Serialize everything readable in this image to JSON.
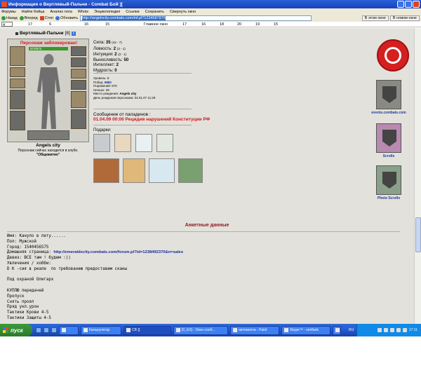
{
  "window": {
    "title": "Информация о Вертлявый-Пальчи - Combat Бой ][",
    "menu": [
      "Форумы",
      "Найти бойца",
      "Анализ лога",
      "Whois",
      "Энциклопедия",
      "Ссылки",
      "Сохранить",
      "Свернуть окно"
    ],
    "toolbar": {
      "back": "Назад",
      "forward": "Вперед",
      "stop": "Стоп",
      "refresh": "Обновить",
      "url": "http://angelscity.combats.com/inf.pl?1234587876",
      "this_window": "В этом окне",
      "new_window": "В новом окне"
    },
    "tabs": [
      "4",
      "17",
      "6",
      "16",
      "15",
      "Главное окно",
      "17",
      "16",
      "18",
      "20",
      "19",
      "15"
    ]
  },
  "character": {
    "name": "Вертлявый-Пальчи",
    "level": "[8]",
    "info_icon": "i",
    "blocked": "Персонаж заблокирован!",
    "hp": "572/572",
    "city": "Angels city",
    "location_note": "Персонаж сейчас находится в клубе.",
    "location_name": "\"Общежитие\""
  },
  "stats": [
    {
      "label": "Сила:",
      "value": "35",
      "extra": "(42 - 7)"
    },
    {
      "label": "Ловкость:",
      "value": "2",
      "extra": "(3 - 1)"
    },
    {
      "label": "Интуиция:",
      "value": "2",
      "extra": "(3 - 1)"
    },
    {
      "label": "Выносливость:",
      "value": "50",
      "extra": ""
    },
    {
      "label": "Интеллект:",
      "value": "2",
      "extra": ""
    },
    {
      "label": "Мудрость:",
      "value": "0",
      "extra": ""
    }
  ],
  "meta": {
    "level": "Уровень: 8",
    "wins_label": "Побед:",
    "wins": "6882",
    "losses": "Поражений: 870",
    "draws": "Ничьих: 29",
    "birthplace_label": "Место рождения:",
    "birthplace": "Angels city",
    "birthday": "День рождения персонажа: 04.01.07 11:29"
  },
  "message": {
    "title": "Сообщение от паладинов :",
    "text": "01.04.09 00:00 Рецидив нарушений Конституции РФ"
  },
  "gifts_label": "Подарки:",
  "sidebar": {
    "events": "events.combats.com",
    "scrolls": "Scrolls",
    "photo_scrolls": "Photo Scrolls"
  },
  "anketa": {
    "title": "Анкетные данные",
    "name": "Имя: Канупо в лету......",
    "gender": "Пол: Мужской",
    "city": "Город: 1540456575",
    "homepage_label": "Домашняя страница: ",
    "homepage": "http://emeraldscity.combats.com/forum.pl?id=1238492370&n=sales",
    "motto": "Девиз: ВСЕ там ! будем :))",
    "hobby_label": "Увлечения / хобби:",
    "hobby": "D К -сия в реале  по требованию предоставим сканы",
    "protection": "Под охраной Олигарх",
    "line1": "КУПЛЮ передачей",
    "line2": "Пропуск",
    "line3": "Снять проял",
    "line4": "Пряд укл.урон",
    "line5": "Тактики Крови 4-5",
    "line6": "Тактики Защиты 4-5"
  },
  "taskbar": {
    "start": "пуск",
    "tasks": [
      "",
      "Калькулятор",
      "CB ][",
      "[0_EX] - Окно сооб...",
      "автомолча - Paint",
      "Skype™ - verifank",
      ""
    ],
    "lang": "RU",
    "clock": "17:11"
  }
}
